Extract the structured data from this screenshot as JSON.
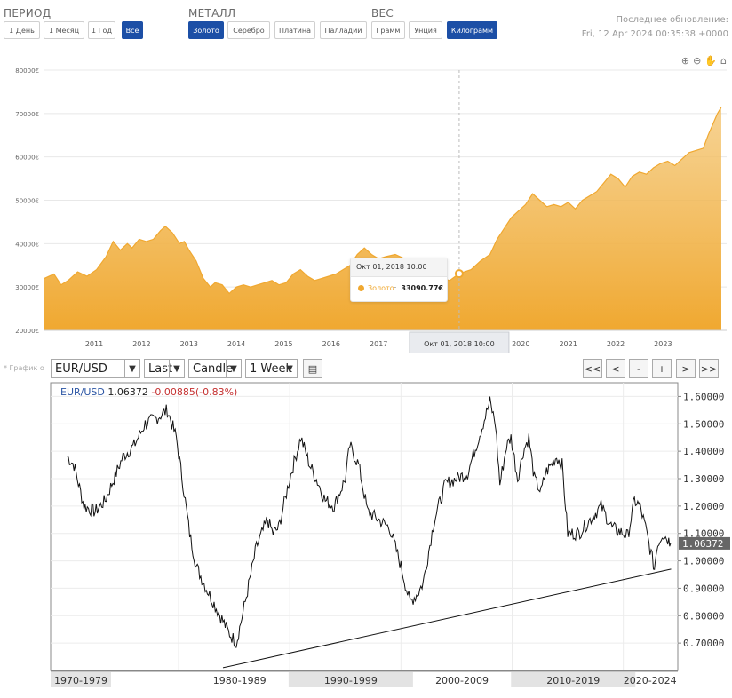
{
  "filters": {
    "period": {
      "title": "ПЕРИОД",
      "options": [
        "1 День",
        "1 Месяц",
        "1 Год",
        "Все"
      ],
      "active": "Все"
    },
    "metal": {
      "title": "МЕТАЛЛ",
      "options": [
        "Золото",
        "Серебро",
        "Платина",
        "Палладий"
      ],
      "active": "Золото"
    },
    "weight": {
      "title": "ВЕС",
      "options": [
        "Грамм",
        "Унция",
        "Килограмм"
      ],
      "active": "Килограмм"
    }
  },
  "last_update": {
    "label": "Последнее обновление:",
    "value": "Fri, 12 Apr 2024 00:35:38 +0000"
  },
  "gold_chart": {
    "toolbar_icons": [
      "zoom-in-icon",
      "zoom-out-icon",
      "pan-hand-icon",
      "home-icon"
    ],
    "tooltip": {
      "title": "Окт 01, 2018 10:00",
      "series": "Золото",
      "value": "33090.77€"
    },
    "crosshair_label": "Окт 01, 2018 10:00",
    "colors": {
      "fill_top": "#f3c46f",
      "fill_bottom": "#f0a830",
      "line": "#f0a830"
    }
  },
  "chart_data": [
    {
      "type": "area",
      "series": [
        {
          "name": "Золото",
          "x": [
            2010.0,
            2010.2,
            2010.35,
            2010.5,
            2010.7,
            2010.9,
            2011.1,
            2011.3,
            2011.45,
            2011.6,
            2011.75,
            2011.85,
            2012.0,
            2012.15,
            2012.3,
            2012.45,
            2012.55,
            2012.7,
            2012.85,
            2012.95,
            2013.05,
            2013.2,
            2013.35,
            2013.5,
            2013.6,
            2013.75,
            2013.9,
            2014.05,
            2014.2,
            2014.35,
            2014.5,
            2014.65,
            2014.8,
            2014.95,
            2015.1,
            2015.25,
            2015.4,
            2015.55,
            2015.7,
            2015.85,
            2016.0,
            2016.15,
            2016.3,
            2016.45,
            2016.6,
            2016.75,
            2016.9,
            2017.05,
            2017.2,
            2017.4,
            2017.6,
            2017.75,
            2017.9,
            2018.05,
            2018.2,
            2018.4,
            2018.55,
            2018.75,
            2019.0,
            2019.2,
            2019.4,
            2019.55,
            2019.7,
            2019.85,
            2020.0,
            2020.15,
            2020.3,
            2020.45,
            2020.6,
            2020.75,
            2020.9,
            2021.05,
            2021.2,
            2021.35,
            2021.5,
            2021.65,
            2021.8,
            2021.95,
            2022.1,
            2022.25,
            2022.4,
            2022.55,
            2022.7,
            2022.85,
            2023.0,
            2023.15,
            2023.3,
            2023.45,
            2023.6,
            2023.75,
            2023.9,
            2024.0,
            2024.1,
            2024.2,
            2024.28
          ],
          "values": [
            32000,
            33000,
            30500,
            31500,
            33500,
            32500,
            34000,
            37000,
            40500,
            38500,
            40000,
            39000,
            41000,
            40500,
            41000,
            43000,
            44000,
            42500,
            40000,
            40500,
            38500,
            36000,
            32000,
            30000,
            31000,
            30500,
            28500,
            30000,
            30500,
            30000,
            30500,
            31000,
            31500,
            30500,
            31000,
            33000,
            34000,
            32500,
            31500,
            32000,
            32500,
            33000,
            34000,
            35000,
            37500,
            39000,
            37500,
            36500,
            37000,
            37500,
            36500,
            35000,
            34500,
            35500,
            33500,
            32000,
            31500,
            33090.77,
            34000,
            36000,
            37500,
            41000,
            43500,
            46000,
            47500,
            49000,
            51500,
            50000,
            48500,
            49000,
            48500,
            49500,
            48000,
            50000,
            51000,
            52000,
            54000,
            56000,
            55000,
            53000,
            55500,
            56500,
            56000,
            57500,
            58500,
            59000,
            58000,
            59500,
            61000,
            61500,
            62000,
            65000,
            67500,
            70000,
            71500
          ]
        }
      ],
      "x_ticks": [
        "2011",
        "2012",
        "2013",
        "2014",
        "2015",
        "2016",
        "2017",
        "2020",
        "2021",
        "2022",
        "2023"
      ],
      "y_ticks": [
        "20000€",
        "30000€",
        "40000€",
        "50000€",
        "60000€",
        "70000€",
        "80000€"
      ],
      "ylim": [
        20000,
        80000
      ]
    },
    {
      "type": "line",
      "series": [
        {
          "name": "EUR/USD",
          "x": [
            1970.0,
            1970.6,
            1971.5,
            1972.5,
            1973.4,
            1974.2,
            1975.0,
            1976.0,
            1977.0,
            1978.0,
            1979.0,
            1979.8,
            1980.4,
            1981.0,
            1981.6,
            1982.5,
            1983.5,
            1984.5,
            1985.2,
            1986.0,
            1987.0,
            1988.0,
            1988.5,
            1989.0,
            1990.0,
            1991.0,
            1991.8,
            1992.6,
            1993.2,
            1994.0,
            1995.0,
            1995.4,
            1996.2,
            1997.0,
            1998.0,
            1999.0,
            1999.5,
            2000.0,
            2000.8,
            2001.5,
            2002.0,
            2003.0,
            2004.0,
            2005.0,
            2006.0,
            2007.0,
            2008.0,
            2008.5,
            2008.9,
            2009.5,
            2009.9,
            2010.5,
            2011.0,
            2011.5,
            2012.0,
            2012.6,
            2013.0,
            2014.0,
            2014.5,
            2015.0,
            2016.0,
            2017.0,
            2018.0,
            2018.5,
            2019.0,
            2020.0,
            2020.4,
            2021.0,
            2021.5,
            2022.0,
            2022.8,
            2023.0,
            2023.5,
            2024.0,
            2024.25
          ],
          "values": [
            1.38,
            1.35,
            1.2,
            1.18,
            1.22,
            1.3,
            1.38,
            1.42,
            1.5,
            1.52,
            1.55,
            1.45,
            1.28,
            1.1,
            0.98,
            0.9,
            0.82,
            0.74,
            0.7,
            0.85,
            1.05,
            1.15,
            1.1,
            1.12,
            1.3,
            1.45,
            1.35,
            1.28,
            1.22,
            1.2,
            1.3,
            1.42,
            1.35,
            1.18,
            1.15,
            1.12,
            1.05,
            0.98,
            0.85,
            0.88,
            0.92,
            1.15,
            1.28,
            1.3,
            1.32,
            1.45,
            1.58,
            1.5,
            1.28,
            1.42,
            1.45,
            1.3,
            1.4,
            1.45,
            1.3,
            1.25,
            1.32,
            1.38,
            1.35,
            1.1,
            1.1,
            1.15,
            1.2,
            1.16,
            1.12,
            1.1,
            1.09,
            1.22,
            1.2,
            1.12,
            0.97,
            1.05,
            1.1,
            1.08,
            1.06372
          ]
        }
      ],
      "trendline": {
        "x": [
          1984.0,
          2024.3
        ],
        "values": [
          0.61,
          0.97
        ]
      },
      "x_ticks": [
        "1970-1979",
        "1980-1989",
        "1990-1999",
        "2000-2009",
        "2010-2019",
        "2020-2024"
      ],
      "y_ticks": [
        "0.70000",
        "0.80000",
        "0.90000",
        "1.00000",
        "1.10000",
        "1.20000",
        "1.30000",
        "1.40000",
        "1.50000",
        "1.60000"
      ],
      "ylim": [
        0.6,
        1.65
      ]
    }
  ],
  "fx_chart": {
    "toolbar_note": "* График о",
    "symbol_select": "EUR/USD",
    "field_select": "Last",
    "type_select": "Candle",
    "interval_select": "1 Week",
    "nav_buttons": [
      "<<",
      "<",
      "-",
      "+",
      ">",
      ">>"
    ],
    "legend": {
      "symbol": "EUR/USD",
      "last": "1.06372",
      "change": "-0.00885(-0.83%)"
    },
    "price_label": "1.06372"
  }
}
